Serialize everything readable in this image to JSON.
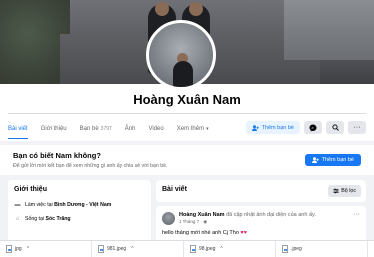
{
  "profile": {
    "name": "Hoàng Xuân Nam"
  },
  "tabs": [
    {
      "label": "Bài viết",
      "count": "",
      "caret": false
    },
    {
      "label": "Giới thiệu",
      "count": "",
      "caret": false
    },
    {
      "label": "Bạn bè",
      "count": "3797",
      "caret": false
    },
    {
      "label": "Ảnh",
      "count": "",
      "caret": false
    },
    {
      "label": "Video",
      "count": "",
      "caret": false
    },
    {
      "label": "Xem thêm",
      "count": "",
      "caret": true
    }
  ],
  "header_actions": {
    "add_friend": "Thêm bạn bè",
    "messenger_icon": "messenger-icon",
    "search_icon": "search-icon",
    "more_icon": "more-icon"
  },
  "suggest": {
    "question": "Bạn có biết Nam không?",
    "subtitle": "Để gửi lời mời kết bạn để xem những gì anh ấy chia sẻ với bạn bè.",
    "button": "Thêm bạn bè"
  },
  "intro": {
    "title": "Giới thiệu",
    "rows": [
      {
        "icon": "briefcase-icon",
        "prefix": "Làm việc tại ",
        "value": "Bình Dương - Việt Nam"
      },
      {
        "icon": "home-icon",
        "prefix": "Sống tại ",
        "value": "Sóc Trăng"
      }
    ]
  },
  "posts": {
    "title": "Bài viết",
    "filter_label": "Bộ lọc",
    "first_post": {
      "author": "Hoàng Xuân Nam",
      "action": " đã cập nhật ảnh đại diện của anh ấy.",
      "time": "1 Tháng 7 · ",
      "text": "hello tháng mới nhé anh Cj Tho ",
      "hearts": "♥♥"
    }
  },
  "downloads": [
    {
      "name": "jpg"
    },
    {
      "name": "981.jpeg"
    },
    {
      "name": "98.jpeg"
    },
    {
      "name": ".jpeg"
    }
  ],
  "colors": {
    "accent": "#1877f2",
    "background": "#f0f2f5"
  }
}
